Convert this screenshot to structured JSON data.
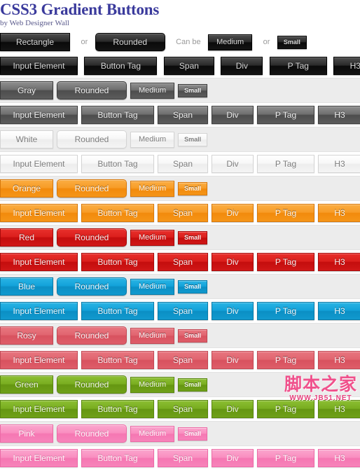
{
  "header": {
    "title": "CSS3 Gradient Buttons",
    "byline": "by Web Designer Wall"
  },
  "labels": {
    "or": "or",
    "can_be": "Can be"
  },
  "shape_row": {
    "rectangle": "Rectangle",
    "rounded": "Rounded",
    "medium": "Medium",
    "small": "Small"
  },
  "tag_labels": {
    "input": "Input Element",
    "button": "Button Tag",
    "span": "Span",
    "div": "Div",
    "ptag": "P Tag",
    "h3": "H3"
  },
  "colors": {
    "black": "#141414",
    "gray": "#5c5c5c",
    "white": "#f4f4f4",
    "orange": "#f59518",
    "red": "#d01717",
    "blue": "#1199ce",
    "rosy": "#de5d69",
    "green": "#6fa018",
    "pink": "#f783ba",
    "title": "#3a3a9c",
    "band": "#ececec"
  },
  "themes": [
    {
      "key": "gray",
      "name": "Gray",
      "rounded": "Rounded",
      "medium": "Medium",
      "small": "Small"
    },
    {
      "key": "white",
      "name": "White",
      "rounded": "Rounded",
      "medium": "Medium",
      "small": "Small"
    },
    {
      "key": "orange",
      "name": "Orange",
      "rounded": "Rounded",
      "medium": "Medium",
      "small": "Small"
    },
    {
      "key": "red",
      "name": "Red",
      "rounded": "Rounded",
      "medium": "Medium",
      "small": "Small"
    },
    {
      "key": "blue",
      "name": "Blue",
      "rounded": "Rounded",
      "medium": "Medium",
      "small": "Small"
    },
    {
      "key": "rosy",
      "name": "Rosy",
      "rounded": "Rounded",
      "medium": "Medium",
      "small": "Small"
    },
    {
      "key": "green",
      "name": "Green",
      "rounded": "Rounded",
      "medium": "Medium",
      "small": "Small"
    },
    {
      "key": "pink",
      "name": "Pink",
      "rounded": "Rounded",
      "medium": "Medium",
      "small": "Small"
    }
  ],
  "watermark": {
    "cn": "脚本之家",
    "url": "WWW.JB51.NET"
  }
}
